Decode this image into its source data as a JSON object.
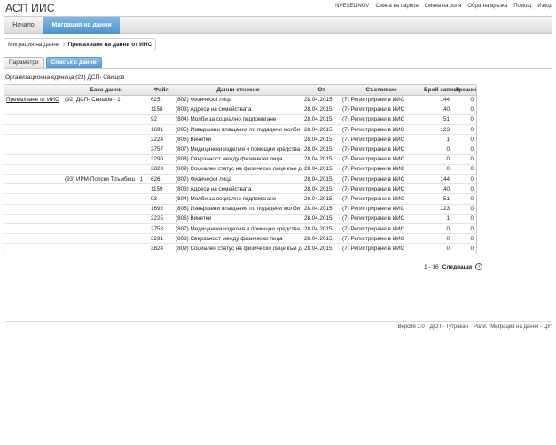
{
  "app": {
    "title": "АСП ИИС"
  },
  "user_links": [
    "NVESELINOV",
    "Смяна на парола",
    "Смяна на роля",
    "Обратна връзка",
    "Помощ",
    "Изход"
  ],
  "nav": {
    "home": "Начало",
    "active": "Миграция на данни"
  },
  "breadcrumb": {
    "parent": "Миграция на данни",
    "current": "Премахване на данни от ИИС"
  },
  "tabs": {
    "params": "Параметри",
    "files": "Списък с данни"
  },
  "org_unit": "Организационна единица (23) ДСП- Свищов",
  "table": {
    "headers": [
      "",
      "База данни",
      "Файл",
      "Данни относно",
      "От",
      "Състояние",
      "Брой записи",
      "Грешки"
    ],
    "action_label": "Премахване от ИИС",
    "rows": [
      [
        "Премахване от ИИС",
        "(92) ДСП- Свищов - 1",
        "625",
        "(802) Физически лица",
        "28.04.2015",
        "(7) Регистрирани в ИИС",
        "144",
        "0"
      ],
      [
        "",
        "",
        "1158",
        "(803) Адреси на семействата",
        "28.04.2015",
        "(7) Регистрирани в ИИС",
        "40",
        "0"
      ],
      [
        "",
        "",
        "92",
        "(804) Молби за социално подпомагане",
        "28.04.2015",
        "(7) Регистрирани в ИИС",
        "51",
        "0"
      ],
      [
        "",
        "",
        "1691",
        "(805) Извършени плащания по подадени молби",
        "28.04.2015",
        "(7) Регистрирани в ИИС",
        "123",
        "0"
      ],
      [
        "",
        "",
        "2224",
        "(806) Винетки",
        "28.04.2015",
        "(7) Регистрирани в ИИС",
        "1",
        "0"
      ],
      [
        "",
        "",
        "2757",
        "(807) Медицински изделия и помощни средства",
        "28.04.2015",
        "(7) Регистрирани в ИИС",
        "0",
        "0"
      ],
      [
        "",
        "",
        "3290",
        "(808) Свързаност между физически лица",
        "28.04.2015",
        "(7) Регистрирани в ИИС",
        "0",
        "0"
      ],
      [
        "",
        "",
        "3823",
        "(809) Социален статус на физическо лице към дата",
        "28.04.2015",
        "(7) Регистрирани в ИИС",
        "0",
        "0"
      ],
      [
        "",
        "(93) ИРМ-Полски Тръмбеш - 1",
        "626",
        "(802) Физически лица",
        "28.04.2015",
        "(7) Регистрирани в ИИС",
        "144",
        "0"
      ],
      [
        "",
        "",
        "1159",
        "(803) Адреси на семействата",
        "28.04.2015",
        "(7) Регистрирани в ИИС",
        "40",
        "0"
      ],
      [
        "",
        "",
        "93",
        "(804) Молби за социално подпомагане",
        "28.04.2015",
        "(7) Регистрирани в ИИС",
        "51",
        "0"
      ],
      [
        "",
        "",
        "1692",
        "(805) Извършени плащания по подадени молби",
        "28.04.2015",
        "(7) Регистрирани в ИИС",
        "123",
        "0"
      ],
      [
        "",
        "",
        "2225",
        "(806) Винетки",
        "28.04.2015",
        "(7) Регистрирани в ИИС",
        "1",
        "0"
      ],
      [
        "",
        "",
        "2758",
        "(807) Медицински изделия и помощни средства",
        "28.04.2015",
        "(7) Регистрирани в ИИС",
        "0",
        "0"
      ],
      [
        "",
        "",
        "3291",
        "(808) Свързаност между физически лица",
        "28.04.2015",
        "(7) Регистрирани в ИИС",
        "0",
        "0"
      ],
      [
        "",
        "",
        "3824",
        "(809) Социален статус на физическо лице към дата",
        "28.04.2015",
        "(7) Регистрирани в ИИС",
        "0",
        "0"
      ]
    ]
  },
  "pager": {
    "range": "1 - 16",
    "next": "Следващи",
    "next_icon": "chevron-right-icon"
  },
  "footer": [
    "Версия 1.0",
    "ДСП - Тутракан",
    "Роли: \"Миграция на данни - ЦУ\""
  ]
}
